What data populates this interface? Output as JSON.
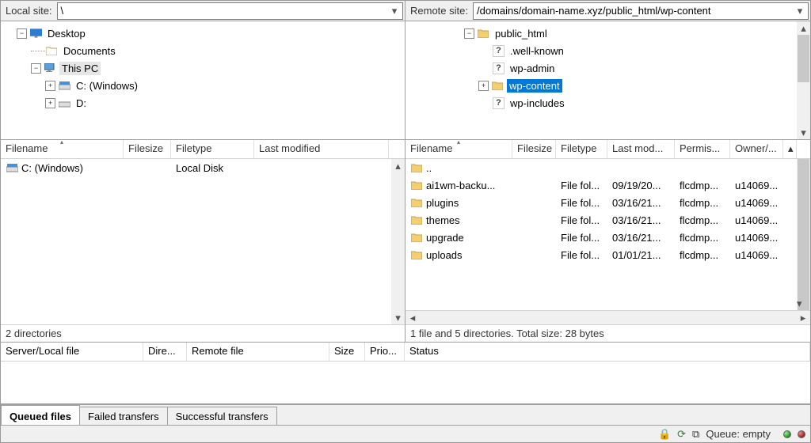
{
  "local": {
    "label": "Local site:",
    "path": "\\",
    "tree": {
      "desktop": "Desktop",
      "documents": "Documents",
      "thispc": "This PC",
      "c": "C: (Windows)",
      "d": "D:"
    },
    "cols": {
      "filename": "Filename",
      "filesize": "Filesize",
      "filetype": "Filetype",
      "lastmod": "Last modified"
    },
    "rows": [
      {
        "name": "C: (Windows)",
        "size": "",
        "type": "Local Disk",
        "mod": ""
      }
    ],
    "status": "2 directories"
  },
  "remote": {
    "label": "Remote site:",
    "path": "/domains/domain-name.xyz/public_html/wp-content",
    "tree": {
      "public_html": "public_html",
      "wellknown": ".well-known",
      "wpadmin": "wp-admin",
      "wpcontent": "wp-content",
      "wpincludes": "wp-includes"
    },
    "cols": {
      "filename": "Filename",
      "filesize": "Filesize",
      "filetype": "Filetype",
      "lastmod": "Last mod...",
      "perms": "Permis...",
      "owner": "Owner/..."
    },
    "rows": [
      {
        "name": "..",
        "size": "",
        "type": "",
        "mod": "",
        "perms": "",
        "owner": ""
      },
      {
        "name": "ai1wm-backu...",
        "size": "",
        "type": "File fol...",
        "mod": "09/19/20...",
        "perms": "flcdmp...",
        "owner": "u14069..."
      },
      {
        "name": "plugins",
        "size": "",
        "type": "File fol...",
        "mod": "03/16/21...",
        "perms": "flcdmp...",
        "owner": "u14069..."
      },
      {
        "name": "themes",
        "size": "",
        "type": "File fol...",
        "mod": "03/16/21...",
        "perms": "flcdmp...",
        "owner": "u14069..."
      },
      {
        "name": "upgrade",
        "size": "",
        "type": "File fol...",
        "mod": "03/16/21...",
        "perms": "flcdmp...",
        "owner": "u14069..."
      },
      {
        "name": "uploads",
        "size": "",
        "type": "File fol...",
        "mod": "01/01/21...",
        "perms": "flcdmp...",
        "owner": "u14069..."
      }
    ],
    "status": "1 file and 5 directories. Total size: 28 bytes"
  },
  "queue": {
    "cols": {
      "server": "Server/Local file",
      "dir": "Dire...",
      "remote": "Remote file",
      "size": "Size",
      "prio": "Prio...",
      "status": "Status"
    }
  },
  "tabs": {
    "queued": "Queued files",
    "failed": "Failed transfers",
    "success": "Successful transfers"
  },
  "statusbar": {
    "queue": "Queue: empty"
  }
}
